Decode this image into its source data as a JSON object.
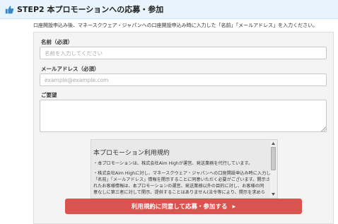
{
  "header": {
    "title": "STEP2 本プロモーションへの応募・参加",
    "icon": "thumbs-up-icon"
  },
  "instruction": "口座開設申込み後、マネースクウェア・ジャパンへの口座開設申込み時に入力した「名前」「メールアドレス」を入力ください。",
  "form": {
    "name_label": "名前（必須）",
    "name_placeholder": "名前を入力してください",
    "email_label": "メールアドレス（必須）",
    "email_placeholder": "example@example.com",
    "request_label": "ご要望",
    "request_value": ""
  },
  "terms": {
    "title": "本プロモーション利用規約",
    "lines": [
      "・本プロモーションは、株式会社Aim Highが運営、発送業務を代行しています。",
      "・株式会社Aim Highに対し、マネースクウェア・ジャパンへの口座開設申込み時に入力した",
      "「名前」「メールアドレス」情報を開示することに同意いただく必要がございます。開示さ",
      "れたお客様情報は、本プロモーションの運営、発送業務以外の目的に対し、お客様の同",
      "意なしに第三者に対して開示、提供することはありません(法令等により、開示を求めら"
    ]
  },
  "submit": {
    "label": "利用規約に同意して応募・参加する",
    "arrow": "▶"
  },
  "colors": {
    "header_bg": "#e8f4fb",
    "accent_blue": "#3a87c8",
    "button_red": "#d9534f"
  }
}
